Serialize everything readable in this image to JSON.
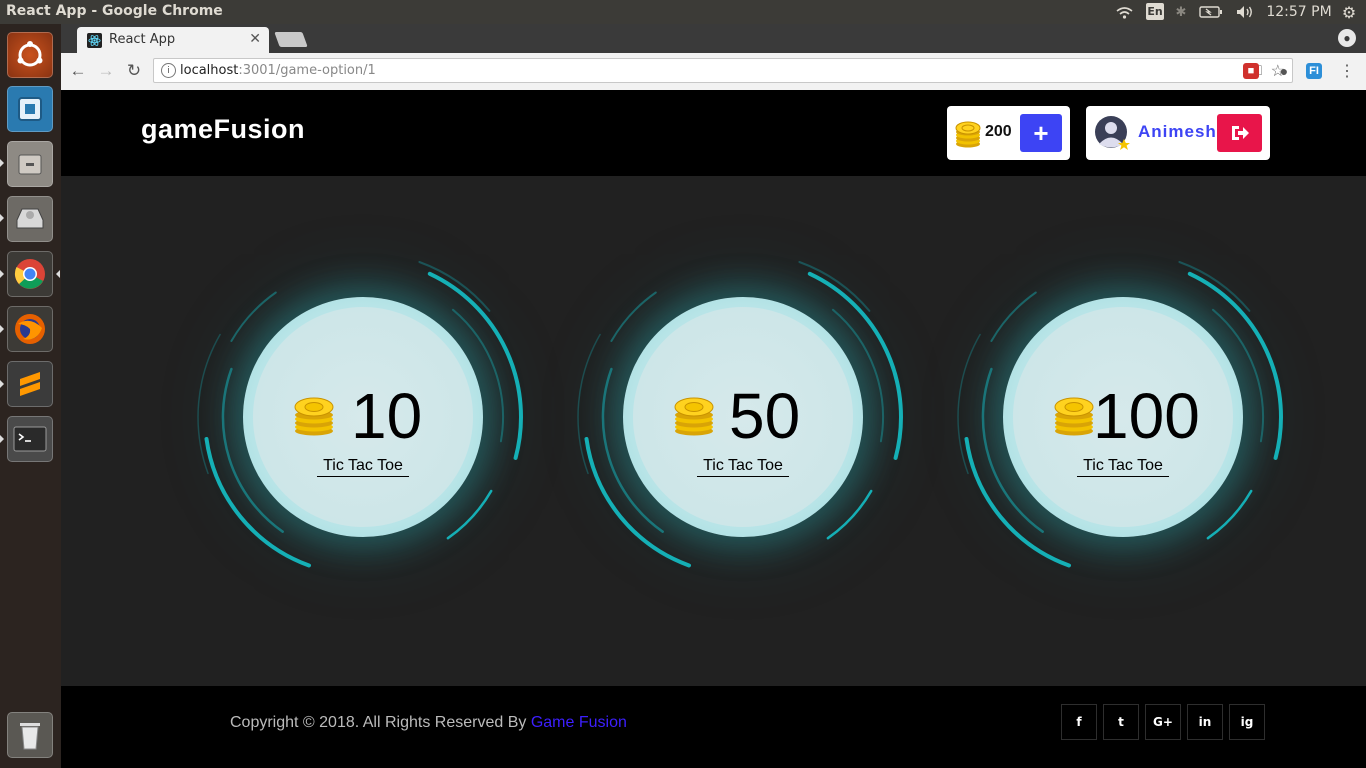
{
  "system": {
    "window_title": "React App - Google Chrome",
    "keyboard_layout": "En",
    "clock": "12:57 PM"
  },
  "browser": {
    "tab_title": "React App",
    "url_host": "localhost",
    "url_path": ":3001/game-option/1"
  },
  "app": {
    "logo": "gameFusion",
    "coins": "200",
    "user_name": "Animesh",
    "options": [
      {
        "stake": "10",
        "game": "Tic Tac Toe"
      },
      {
        "stake": "50",
        "game": "Tic Tac Toe"
      },
      {
        "stake": "100",
        "game": "Tic Tac Toe"
      }
    ],
    "footer": {
      "copyright": "Copyright © 2018. All Rights Reserved By ",
      "brand_link": "Game Fusion",
      "social": [
        "f",
        "t",
        "G+",
        "in",
        "ig"
      ]
    }
  },
  "colors": {
    "accent_blue": "#3d44f4",
    "logout_red": "#e8154a",
    "ring_teal": "#16b3b9",
    "link_blue": "#3d1fff"
  },
  "icons": {
    "add_coins": "plus-icon",
    "logout": "sign-out-icon",
    "coins": "coin-stack-icon",
    "avatar": "user-avatar-icon"
  }
}
